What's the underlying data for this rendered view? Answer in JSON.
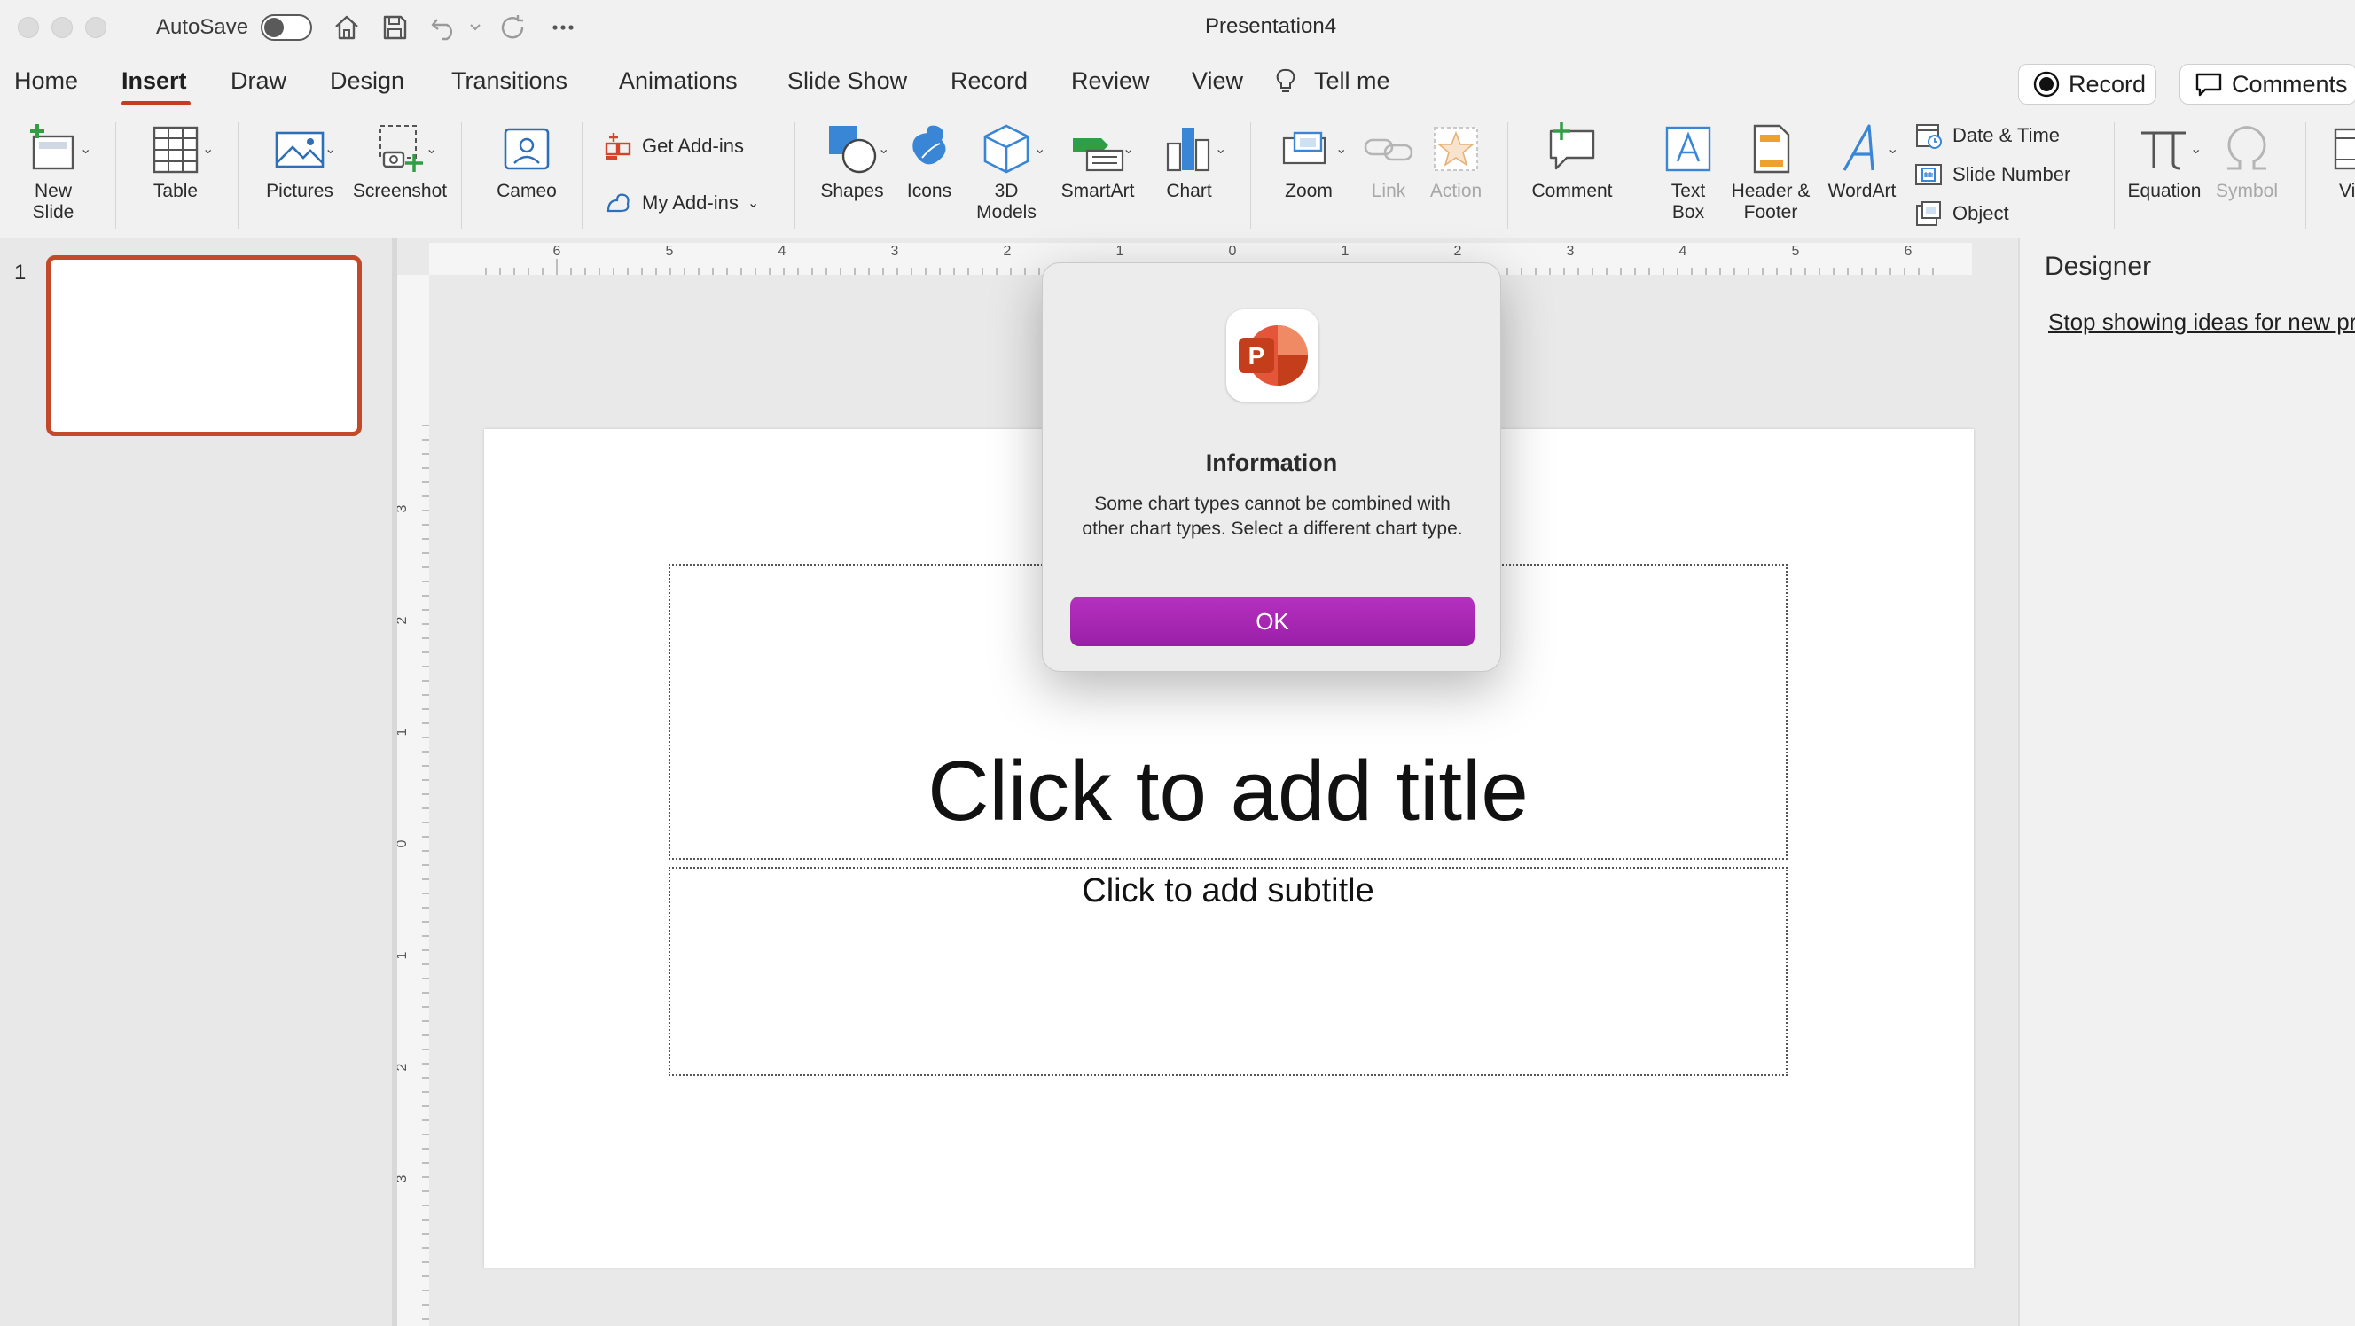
{
  "window": {
    "title": "Presentation4",
    "autosave_label": "AutoSave",
    "autosave_on": false
  },
  "tabs": [
    {
      "label": "Home"
    },
    {
      "label": "Insert",
      "active": true
    },
    {
      "label": "Draw"
    },
    {
      "label": "Design"
    },
    {
      "label": "Transitions"
    },
    {
      "label": "Animations"
    },
    {
      "label": "Slide Show"
    },
    {
      "label": "Record"
    },
    {
      "label": "Review"
    },
    {
      "label": "View"
    },
    {
      "label": "Tell me"
    }
  ],
  "header_buttons": {
    "record": "Record",
    "comments": "Comments"
  },
  "ribbon": {
    "new_slide": [
      "New",
      "Slide"
    ],
    "table": "Table",
    "pictures": "Pictures",
    "screenshot": "Screenshot",
    "cameo": "Cameo",
    "get_addins": "Get Add-ins",
    "my_addins": "My Add-ins",
    "shapes": "Shapes",
    "icons": "Icons",
    "models": [
      "3D",
      "Models"
    ],
    "smartart": "SmartArt",
    "chart": "Chart",
    "zoom": "Zoom",
    "link": "Link",
    "action": "Action",
    "comment": "Comment",
    "text_box": [
      "Text",
      "Box"
    ],
    "header_footer": [
      "Header &",
      "Footer"
    ],
    "wordart": "WordArt",
    "date_time": "Date & Time",
    "slide_number": "Slide Number",
    "object": "Object",
    "equation": "Equation",
    "symbol": "Symbol",
    "video_partial": "Vi"
  },
  "thumbnails": [
    {
      "number": "1"
    }
  ],
  "ruler": {
    "h_labels": [
      "6",
      "5",
      "4",
      "3",
      "2",
      "1",
      "0",
      "1",
      "2",
      "3",
      "4",
      "5",
      "6"
    ],
    "v_labels": [
      "3",
      "2",
      "1",
      "0",
      "1",
      "2",
      "3"
    ]
  },
  "slide": {
    "title_placeholder": "Click to add title",
    "subtitle_placeholder": "Click to add subtitle"
  },
  "designer": {
    "title": "Designer",
    "link": "Stop showing ideas for new presentations"
  },
  "dialog": {
    "title": "Information",
    "message": "Some chart types cannot be combined with other chart types. Select a different chart type.",
    "ok_label": "OK",
    "accent": "#a726b4"
  }
}
